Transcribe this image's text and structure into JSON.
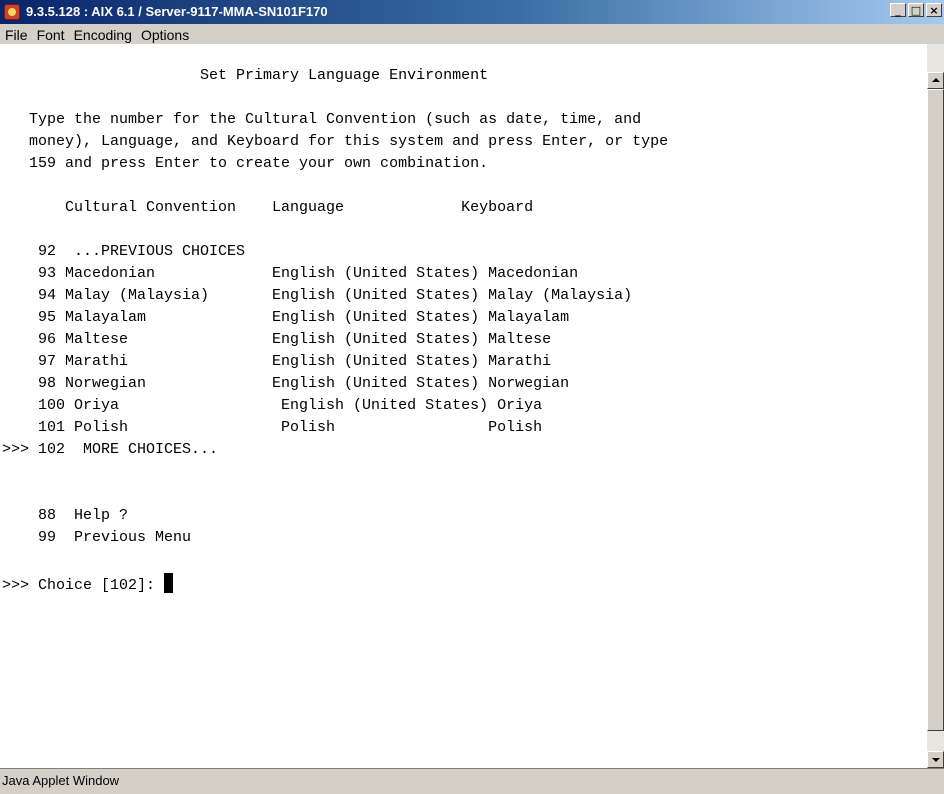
{
  "window": {
    "title": "9.3.5.128 : AIX 6.1 / Server-9117-MMA-SN101F170",
    "buttons": [
      "_",
      "□",
      "×"
    ]
  },
  "menu": [
    "File",
    "Font",
    "Encoding",
    "Options"
  ],
  "terminal": {
    "lines": [
      "",
      "                      Set Primary Language Environment",
      "",
      "   Type the number for the Cultural Convention (such as date, time, and",
      "   money), Language, and Keyboard for this system and press Enter, or type",
      "   159 and press Enter to create your own combination.",
      "",
      "       Cultural Convention    Language             Keyboard",
      "",
      "    92  ...PREVIOUS CHOICES",
      "    93 Macedonian             English (United States) Macedonian",
      "    94 Malay (Malaysia)       English (United States) Malay (Malaysia)",
      "    95 Malayalam              English (United States) Malayalam",
      "    96 Maltese                English (United States) Maltese",
      "    97 Marathi                English (United States) Marathi",
      "    98 Norwegian              English (United States) Norwegian",
      "    100 Oriya                  English (United States) Oriya",
      "    101 Polish                 Polish                 Polish",
      ">>> 102  MORE CHOICES...",
      "",
      "",
      "    88  Help ?",
      "    99  Previous Menu",
      "",
      ">>> Choice [102]: "
    ],
    "cursor_line": 24
  },
  "status": {
    "text": "Java Applet Window"
  }
}
